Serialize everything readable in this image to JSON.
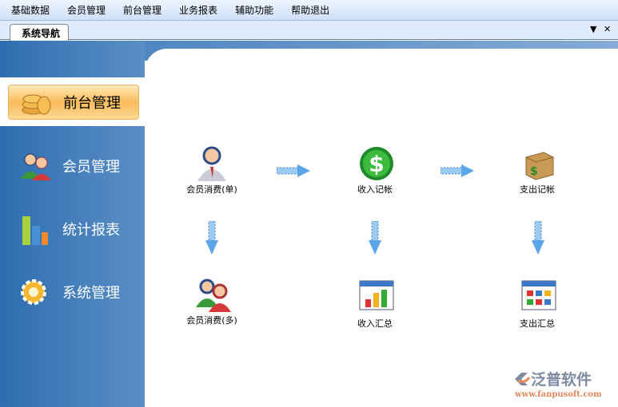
{
  "menu": [
    "基础数据",
    "会员管理",
    "前台管理",
    "业务报表",
    "辅助功能",
    "帮助退出"
  ],
  "tab": {
    "label": "系统导航",
    "dropdown": "▼",
    "close": "✕"
  },
  "nav": [
    {
      "label": "前台管理",
      "icon": "coins-icon"
    },
    {
      "label": "会员管理",
      "icon": "users-icon"
    },
    {
      "label": "统计报表",
      "icon": "bar-chart-icon"
    },
    {
      "label": "系统管理",
      "icon": "gear-icon"
    }
  ],
  "flow": {
    "member_single": "会员消费(单)",
    "income_entry": "收入记帐",
    "expense_entry": "支出记帐",
    "member_multi": "会员消费(多)",
    "income_summary": "收入汇总",
    "expense_summary": "支出汇总"
  },
  "logo": {
    "name": "泛普软件",
    "url": "www.fanpusoft.com"
  }
}
